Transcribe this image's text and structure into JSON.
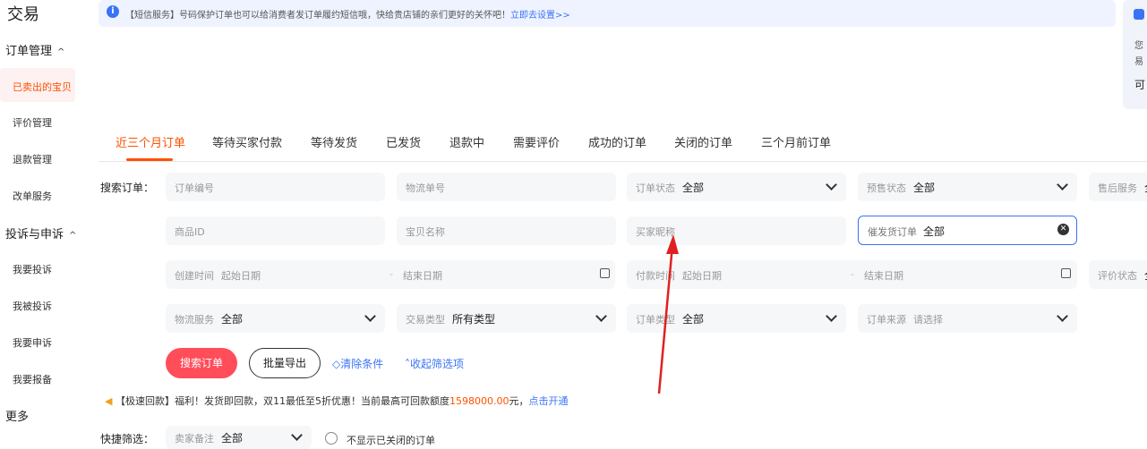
{
  "sidebar": {
    "brand": "交易",
    "groups": [
      {
        "label": "订单管理",
        "caret": "^"
      },
      {
        "label": "投诉与申诉",
        "caret": "^"
      },
      {
        "label": "更多"
      }
    ],
    "order_items": [
      "已卖出的宝贝",
      "评价管理",
      "退款管理",
      "改单服务"
    ],
    "complaint_items": [
      "我要投诉",
      "我被投诉",
      "我要申诉",
      "我要报备"
    ]
  },
  "notice": {
    "icon": "info-icon",
    "text": "【短信服务】号码保护订单也可以给消费者发订单履约短信哦，快给贵店铺的亲们更好的关怀吧！",
    "link": "立即去设置>>"
  },
  "right_card": {
    "line1": "您",
    "line2": "易",
    "line3": "可"
  },
  "tabs": [
    "近三个月订单",
    "等待买家付款",
    "等待发货",
    "已发货",
    "退款中",
    "需要评价",
    "成功的订单",
    "关闭的订单",
    "三个月前订单"
  ],
  "search": {
    "label": "搜索订单：",
    "order_no_placeholder": "订单编号",
    "logistics_no_placeholder": "物流单号",
    "order_status": {
      "label": "订单状态",
      "value": "全部"
    },
    "presale_status": {
      "label": "预售状态",
      "value": "全部"
    },
    "aftersale_status": {
      "label": "售后服务",
      "value": "全"
    },
    "product_id_placeholder": "商品ID",
    "item_name_placeholder": "宝贝名称",
    "buyer_nick_placeholder": "买家昵称",
    "urge_ship": {
      "label": "催发货订单",
      "value": "全部"
    },
    "create_time": {
      "label": "创建时间",
      "start": "起始日期",
      "dash": "-",
      "end": "结束日期"
    },
    "pay_time": {
      "label": "付款时间",
      "start": "起始日期",
      "dash": "-",
      "end": "结束日期"
    },
    "review_status": {
      "label": "评价状态",
      "value": "全"
    },
    "logistics_service": {
      "label": "物流服务",
      "value": "全部"
    },
    "trade_type": {
      "label": "交易类型",
      "value": "所有类型"
    },
    "order_type": {
      "label": "订单类型",
      "value": "全部"
    },
    "order_source": {
      "label": "订单来源",
      "value": "请选择"
    }
  },
  "actions": {
    "search_button": "搜索订单",
    "export_button": "批量导出",
    "clear_link": "清除条件",
    "collapse_link": "收起筛选项"
  },
  "promo": {
    "prefix": "【极速回款】福利！发货即回款，双11最低至5折优惠！当前最高可回款额度",
    "amount": "1598000.00",
    "suffix": "元，",
    "link": "点击开通"
  },
  "quick_filter": {
    "label": "快捷筛选：",
    "seller_note": {
      "label": "卖家备注",
      "value": "全部"
    },
    "hide_closed_label": "不显示已关闭的订单"
  },
  "colors": {
    "accent": "#ff5000",
    "link": "#3a73f5",
    "primary_button": "#ff4d5a",
    "annotation_arrow": "#e02020"
  }
}
